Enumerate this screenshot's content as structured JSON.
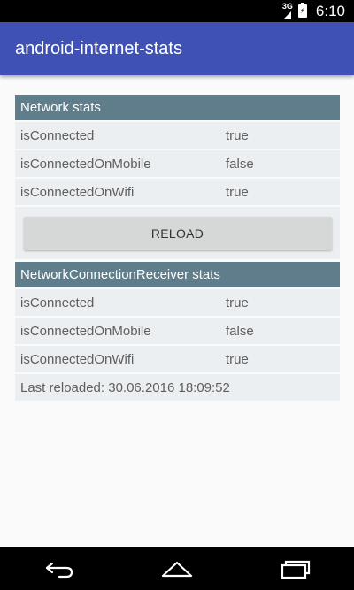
{
  "status_bar": {
    "network_label": "3G",
    "battery_icon": "battery-charging-icon",
    "battery_glyph": "⚡",
    "time": "6:10"
  },
  "app_bar": {
    "title": "android-internet-stats"
  },
  "network_stats": {
    "header": "Network stats",
    "rows": [
      {
        "key": "isConnected",
        "value": "true"
      },
      {
        "key": "isConnectedOnMobile",
        "value": "false"
      },
      {
        "key": "isConnectedOnWifi",
        "value": "true"
      }
    ],
    "reload_label": "RELOAD"
  },
  "receiver_stats": {
    "header": "NetworkConnectionReceiver stats",
    "rows": [
      {
        "key": "isConnected",
        "value": "true"
      },
      {
        "key": "isConnectedOnMobile",
        "value": "false"
      },
      {
        "key": "isConnectedOnWifi",
        "value": "true"
      }
    ],
    "last_reloaded": "Last reloaded: 30.06.2016 18:09:52"
  },
  "nav_bar": {
    "icons": [
      "back-icon",
      "home-icon",
      "recents-icon"
    ]
  },
  "colors": {
    "app_bar": "#3f51b5",
    "section_header": "#607d8b",
    "row_background": "#eceff1",
    "button": "#d6d7d7"
  }
}
